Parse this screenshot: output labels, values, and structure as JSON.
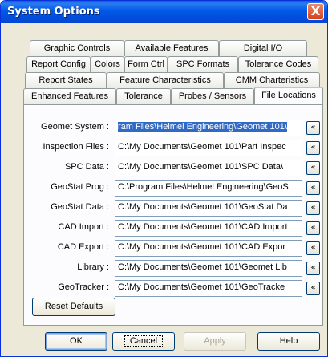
{
  "window": {
    "title": "System Options",
    "close_glyph": "X"
  },
  "tabs": {
    "row1": [
      "Graphic Controls",
      "Available Features",
      "Digital I/O"
    ],
    "row2": [
      "Report Config",
      "Colors",
      "Form Ctrl",
      "SPC Formats",
      "Tolerance Codes"
    ],
    "row3": [
      "Report States",
      "Feature Characteristics",
      "CMM Charteristics"
    ],
    "row4": [
      "Enhanced Features",
      "Tolerance",
      "Probes / Sensors",
      "File Locations"
    ],
    "active": "File Locations"
  },
  "locations": [
    {
      "label": "Geomet System :",
      "value": "ram Files\\Helmel Engineering\\Geomet 101\\"
    },
    {
      "label": "Inspection Files :",
      "value": "C:\\My Documents\\Geomet 101\\Part Inspec"
    },
    {
      "label": "SPC Data :",
      "value": "C:\\My Documents\\Geomet 101\\SPC Data\\"
    },
    {
      "label": "GeoStat Prog :",
      "value": "C:\\Program Files\\Helmel Engineering\\GeoS"
    },
    {
      "label": "GeoStat Data :",
      "value": "C:\\My Documents\\Geomet 101\\GeoStat Da"
    },
    {
      "label": "CAD Import :",
      "value": "C:\\My Documents\\Geomet 101\\CAD Import"
    },
    {
      "label": "CAD Export :",
      "value": "C:\\My Documents\\Geomet 101\\CAD Expor"
    },
    {
      "label": "Library :",
      "value": "C:\\My Documents\\Geomet 101\\Geomet Lib"
    },
    {
      "label": "GeoTracker :",
      "value": "C:\\My Documents\\Geomet 101\\GeoTracke"
    }
  ],
  "browse_glyph": "«",
  "buttons": {
    "reset": "Reset Defaults",
    "ok": "OK",
    "cancel": "Cancel",
    "apply": "Apply",
    "help": "Help"
  },
  "colors": {
    "titlebar": "#0058e8",
    "selection": "#316ac5",
    "dialog_bg": "#ece9d8",
    "close_button": "#d6401b"
  }
}
